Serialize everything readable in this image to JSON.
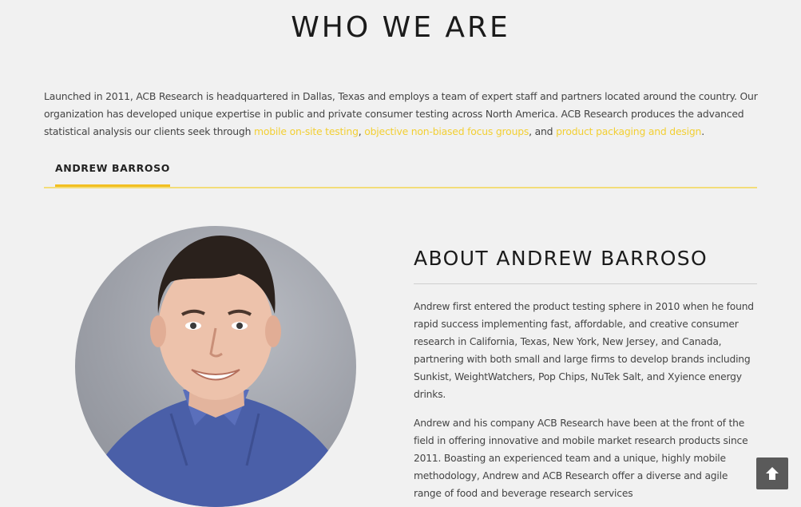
{
  "section": {
    "title": "WHO WE ARE"
  },
  "intro": {
    "part1": "Launched in 2011, ACB Research is headquartered in Dallas, Texas and employs a team of expert staff and partners located around the country. Our organization has developed unique expertise in public and private consumer testing across North America. ACB Research produces the advanced statistical analysis our clients seek through ",
    "link1": "mobile on-site testing",
    "sep1": ", ",
    "link2": "objective non-biased focus groups",
    "sep2": ", and ",
    "link3": "product packaging and design",
    "end": "."
  },
  "tabs": [
    {
      "label": "ANDREW BARROSO"
    }
  ],
  "about": {
    "title": "ABOUT ANDREW BARROSO",
    "paragraph1": "Andrew first entered the product testing sphere in 2010 when he found rapid success implementing fast, affordable, and creative consumer research in California, Texas, New York, New Jersey, and Canada, partnering with both small and large firms to develop brands including Sunkist, WeightWatchers, Pop Chips, NuTek Salt, and Xyience energy drinks.",
    "paragraph2": "Andrew and his company ACB Research have been at the front of the field in offering innovative and mobile market research products since 2011. Boasting an experienced team and a unique, highly mobile methodology, Andrew and ACB Research offer a diverse and agile range of food and beverage research services"
  },
  "icons": {
    "back_to_top": "arrow-up-icon",
    "portrait": "portrait-photo"
  },
  "colors": {
    "accent": "#f2bf21",
    "link": "#f2cf33",
    "background": "#f1f1f1"
  }
}
